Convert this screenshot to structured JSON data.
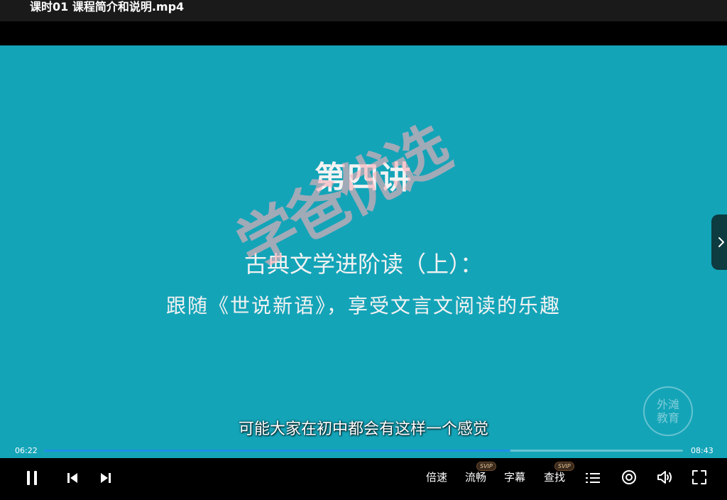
{
  "window": {
    "title": "课时01 课程简介和说明.mp4"
  },
  "video": {
    "lecture_number": "第四讲",
    "lecture_title": "古典文学进阶读（上）：",
    "lecture_subtitle": "跟随《世说新语》，享受文言文阅读的乐趣",
    "watermark": "学爸优选",
    "corner_logo_line1": "外滩",
    "corner_logo_line2": "教育",
    "caption": "可能大家在初中都会有这样一个感觉"
  },
  "playback": {
    "current_time": "06:22",
    "total_time": "08:43",
    "progress": 0.73
  },
  "controls": {
    "speed_label": "倍速",
    "quality_label": "流畅",
    "quality_badge": "SVIP",
    "subtitle_label": "字幕",
    "search_label": "查找",
    "search_badge": "SVIP",
    "icons": [
      "pause-icon",
      "previous-icon",
      "next-icon",
      "playlist-icon",
      "eye-icon",
      "volume-icon",
      "fullscreen-icon",
      "chevron-right-icon"
    ]
  },
  "colors": {
    "video_background": "#14a4b8",
    "progress_fill": "#1e8fe8",
    "watermark": "#f8afb6"
  }
}
